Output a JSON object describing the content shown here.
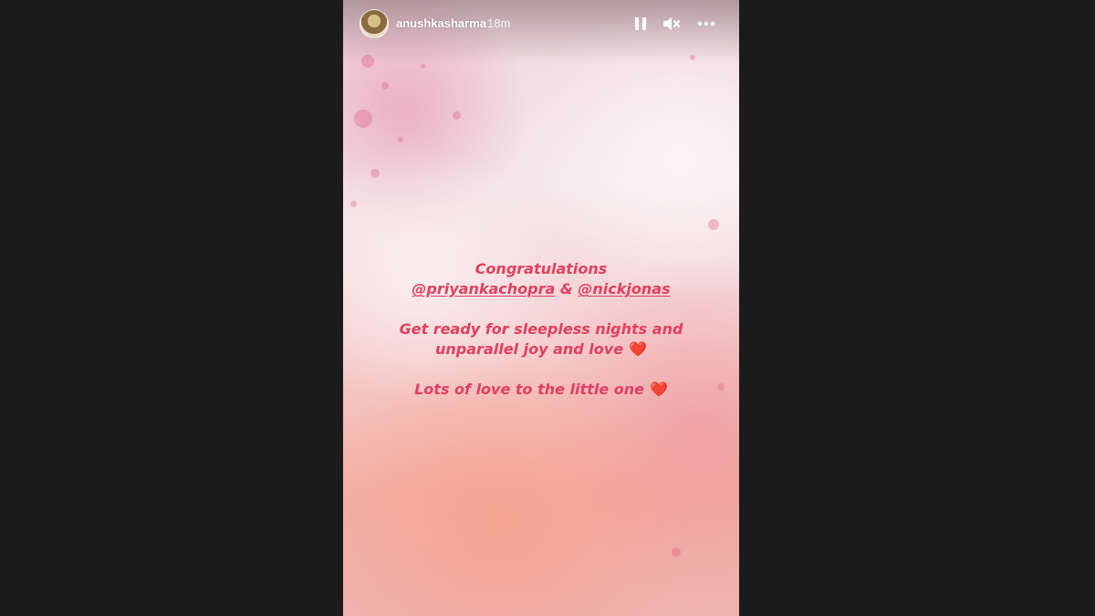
{
  "story": {
    "username": "anushkasharma",
    "timestamp": "18m",
    "controls": {
      "pause_icon": "pause-icon",
      "mute_icon": "speaker-muted-icon",
      "more_icon": "more-options-icon"
    },
    "message": {
      "greeting": "Congratulations",
      "mention_1": "@priyankachopra",
      "conjunction": "&",
      "mention_2": "@nickjonas",
      "line_3": "Get ready for sleepless nights and",
      "line_4": "unparallel joy and love",
      "line_5": "Lots of love to the little one",
      "heart": "❤️"
    }
  },
  "colors": {
    "text_accent": "#e23f5f",
    "background_dark": "#1b1b1b"
  }
}
